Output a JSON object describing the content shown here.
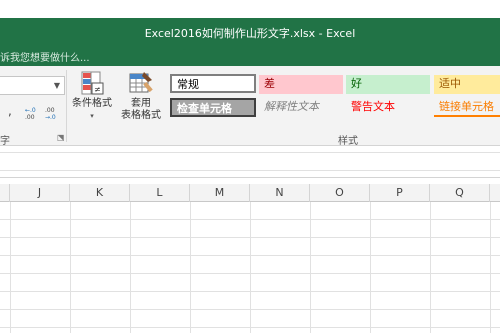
{
  "window": {
    "title": "Excel2016如何制作山形文字.xlsx - Excel",
    "tell_me": "诉我您想要做什么..."
  },
  "ribbon": {
    "number": {
      "comma": ",",
      "increase_decimal": "+.0 .00",
      "decrease_decimal": ".00 →.0",
      "group_label_partial": "字"
    },
    "conditional_formatting": {
      "label": "条件格式",
      "dropdown": "▾"
    },
    "format_as_table": {
      "label_line1": "套用",
      "label_line2": "表格格式",
      "dropdown": "▾"
    },
    "styles": {
      "normal": "常规",
      "bad": "差",
      "good": "好",
      "neutral": "适中",
      "check_cell": "检查单元格",
      "explanatory": "解释性文本",
      "warning": "警告文本",
      "linked_cell": "链接单元格",
      "group_label": "样式"
    }
  },
  "grid": {
    "columns": [
      "J",
      "K",
      "L",
      "M",
      "N",
      "O",
      "P",
      "Q"
    ]
  },
  "colors": {
    "title_bar": "#217346",
    "bad_fill": "#ffc7ce",
    "good_fill": "#c6efce",
    "neutral_fill": "#ffeb9c"
  }
}
